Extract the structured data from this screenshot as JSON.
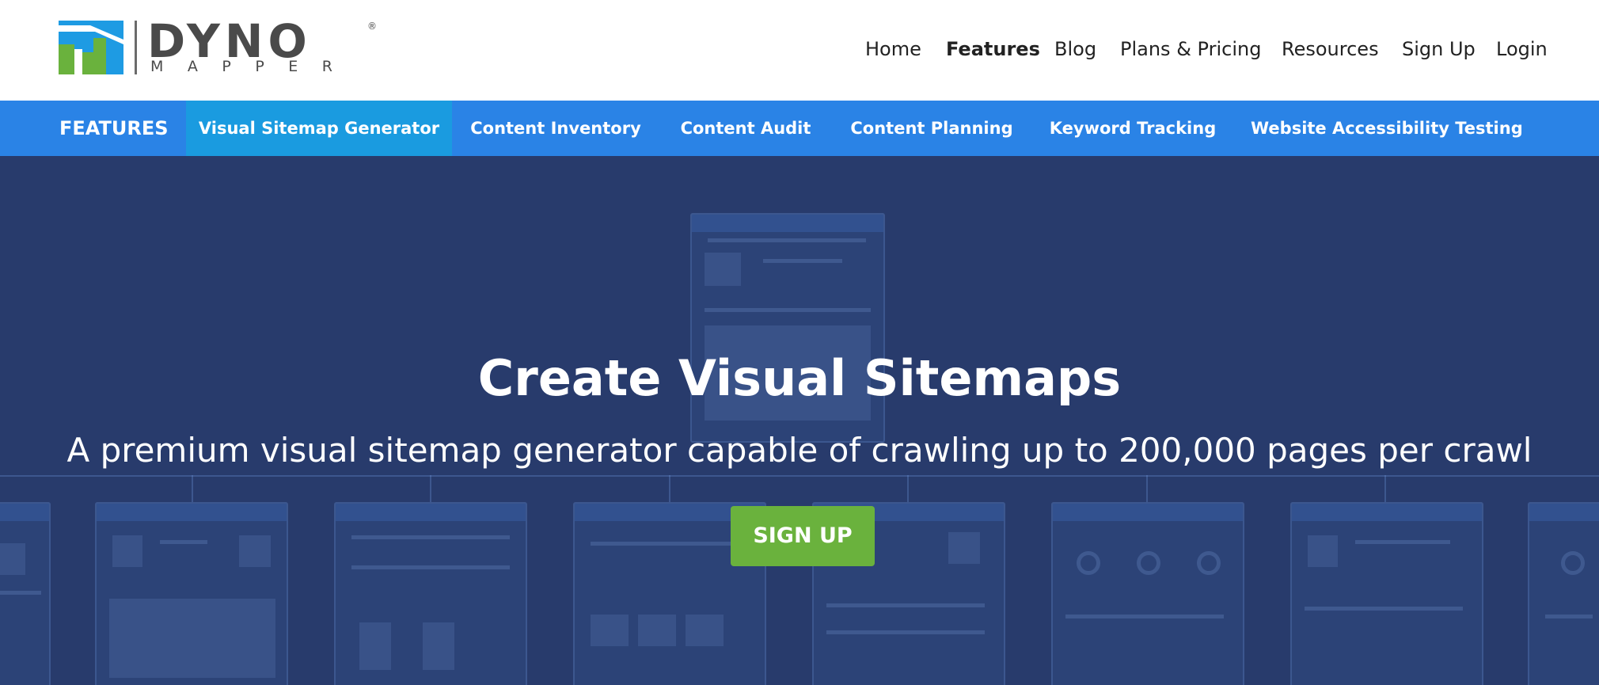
{
  "brand": {
    "name": "DYNO",
    "sub": "MAPPER",
    "reg": "®",
    "colors": {
      "blue": "#1e9be3",
      "green": "#6ab23d",
      "gray": "#4a4a4a"
    }
  },
  "main_nav": {
    "items": [
      {
        "label": "Home"
      },
      {
        "label": "Features",
        "active": true
      },
      {
        "label": "Blog"
      },
      {
        "label": "Plans & Pricing"
      },
      {
        "label": "Resources"
      },
      {
        "label": "Sign Up"
      },
      {
        "label": "Login"
      }
    ]
  },
  "features_bar": {
    "label": "FEATURES",
    "background": "#2a83e6",
    "tabs": [
      {
        "label": "Visual Sitemap Generator",
        "active": true
      },
      {
        "label": "Content Inventory"
      },
      {
        "label": "Content Audit"
      },
      {
        "label": "Content Planning"
      },
      {
        "label": "Keyword Tracking"
      },
      {
        "label": "Website Accessibility Testing"
      }
    ]
  },
  "hero": {
    "title": "Create Visual Sitemaps",
    "subtitle": "A premium visual sitemap generator capable of crawling up to 200,000 pages per crawl",
    "cta_label": "SIGN UP",
    "background": "#283b6c",
    "cta_color": "#6ab23d"
  }
}
